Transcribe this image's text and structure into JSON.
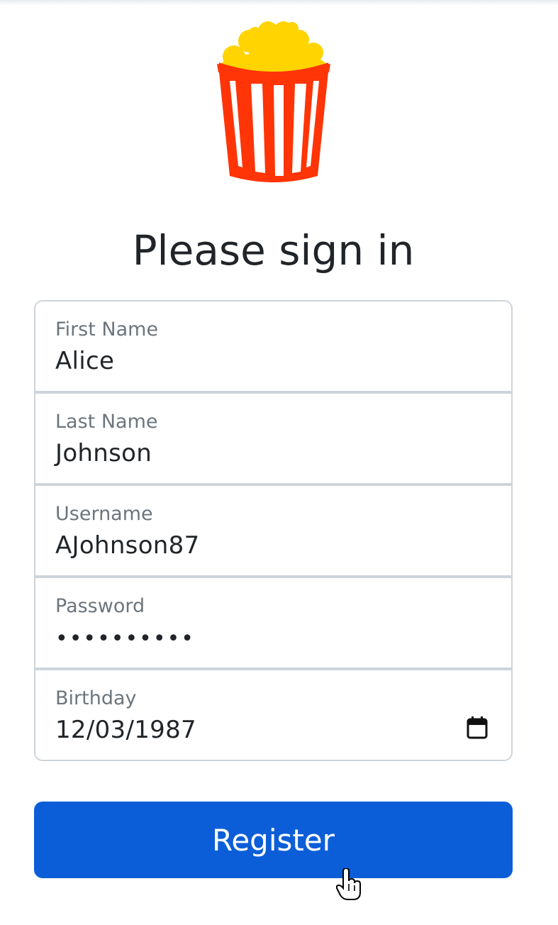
{
  "header": {
    "logo_icon": "popcorn-bucket-icon",
    "title": "Please sign in"
  },
  "form": {
    "fields": [
      {
        "label": "First Name",
        "value": "Alice"
      },
      {
        "label": "Last Name",
        "value": "Johnson"
      },
      {
        "label": "Username",
        "value": "AJohnson87"
      },
      {
        "label": "Password",
        "value": "••••••••••"
      },
      {
        "label": "Birthday",
        "value": "12/03/1987",
        "icon": "calendar-icon"
      }
    ],
    "submit_label": "Register"
  },
  "colors": {
    "button": "#0b5ed7",
    "bucket_red": "#ff3407",
    "popcorn_yellow": "#ffd400",
    "border": "#ced4da",
    "label": "#6c757d"
  },
  "cursor": {
    "icon": "hand-pointer-icon"
  }
}
